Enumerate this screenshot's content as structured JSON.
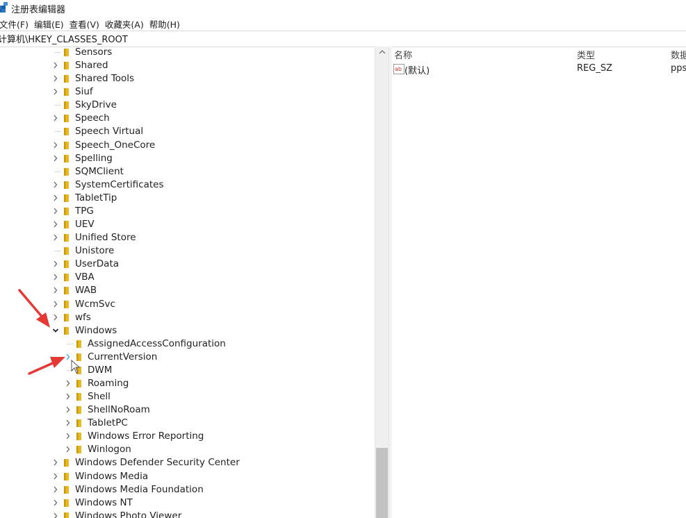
{
  "window": {
    "title": "注册表编辑器",
    "icon": "regedit-icon"
  },
  "menu": [
    {
      "label": "文件(F)"
    },
    {
      "label": "编辑(E)"
    },
    {
      "label": "查看(V)"
    },
    {
      "label": "收藏夹(A)"
    },
    {
      "label": "帮助(H)"
    }
  ],
  "address": {
    "value": "计算机\\HKEY_CLASSES_ROOT"
  },
  "tree": [
    {
      "label": "Sensors",
      "expander": "none"
    },
    {
      "label": "Shared",
      "expander": "collapsed"
    },
    {
      "label": "Shared Tools",
      "expander": "collapsed"
    },
    {
      "label": "Siuf",
      "expander": "collapsed"
    },
    {
      "label": "SkyDrive",
      "expander": "none"
    },
    {
      "label": "Speech",
      "expander": "collapsed"
    },
    {
      "label": "Speech Virtual",
      "expander": "none"
    },
    {
      "label": "Speech_OneCore",
      "expander": "collapsed"
    },
    {
      "label": "Spelling",
      "expander": "collapsed"
    },
    {
      "label": "SQMClient",
      "expander": "none"
    },
    {
      "label": "SystemCertificates",
      "expander": "collapsed"
    },
    {
      "label": "TabletTip",
      "expander": "collapsed"
    },
    {
      "label": "TPG",
      "expander": "collapsed"
    },
    {
      "label": "UEV",
      "expander": "collapsed"
    },
    {
      "label": "Unified Store",
      "expander": "collapsed"
    },
    {
      "label": "Unistore",
      "expander": "none"
    },
    {
      "label": "UserData",
      "expander": "collapsed"
    },
    {
      "label": "VBA",
      "expander": "collapsed"
    },
    {
      "label": "WAB",
      "expander": "collapsed"
    },
    {
      "label": "WcmSvc",
      "expander": "collapsed"
    },
    {
      "label": "wfs",
      "expander": "collapsed"
    },
    {
      "label": "Windows",
      "expander": "expanded"
    },
    {
      "label": "AssignedAccessConfiguration",
      "expander": "none",
      "child": true
    },
    {
      "label": "CurrentVersion",
      "expander": "collapsed",
      "child": true,
      "hover": true
    },
    {
      "label": "DWM",
      "expander": "none",
      "child": true
    },
    {
      "label": "Roaming",
      "expander": "collapsed",
      "child": true
    },
    {
      "label": "Shell",
      "expander": "collapsed",
      "child": true
    },
    {
      "label": "ShellNoRoam",
      "expander": "collapsed",
      "child": true
    },
    {
      "label": "TabletPC",
      "expander": "collapsed",
      "child": true
    },
    {
      "label": "Windows Error Reporting",
      "expander": "collapsed",
      "child": true
    },
    {
      "label": "Winlogon",
      "expander": "collapsed",
      "child": true
    },
    {
      "label": "Windows Defender Security Center",
      "expander": "collapsed"
    },
    {
      "label": "Windows Media",
      "expander": "collapsed"
    },
    {
      "label": "Windows Media Foundation",
      "expander": "collapsed"
    },
    {
      "label": "Windows NT",
      "expander": "collapsed"
    },
    {
      "label": "Windows Photo Viewer",
      "expander": "collapsed"
    }
  ],
  "list": {
    "columns": [
      "名称",
      "类型",
      "数据"
    ],
    "rows": [
      {
        "name": "(默认)",
        "type": "REG_SZ",
        "data": "pps",
        "icon": "string-value-icon"
      }
    ]
  },
  "colors": {
    "folder": "#e8b923",
    "arrow": "#e53935",
    "hover_chevron": "#3a9ad9"
  }
}
